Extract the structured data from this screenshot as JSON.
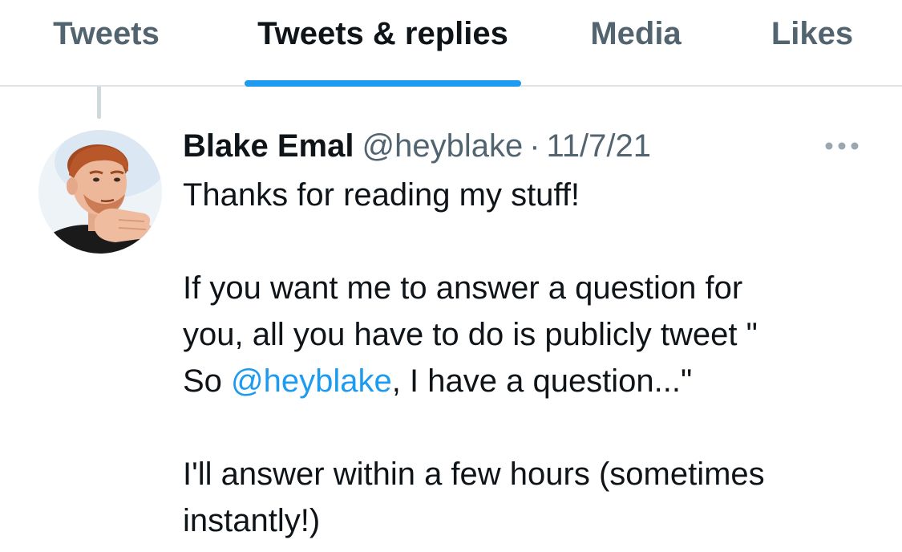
{
  "tabs": [
    {
      "label": "Tweets",
      "active": false
    },
    {
      "label": "Tweets & replies",
      "active": true
    },
    {
      "label": "Media",
      "active": false
    },
    {
      "label": "Likes",
      "active": false
    }
  ],
  "colors": {
    "accent": "#1d9bf0",
    "primary_text": "#0f1419",
    "secondary_text": "#536471",
    "divider": "#dfe4e8"
  },
  "tweet": {
    "author": {
      "name": "Blake Emal",
      "handle": "@heyblake",
      "avatar_icon": "avatar-photo"
    },
    "separator": "·",
    "date": "11/7/21",
    "more_icon": "more-dots-icon",
    "body": {
      "line1": "Thanks for reading my stuff!",
      "line2": "If you want me to answer a question for",
      "line3": "you, all you have to do is publicly tweet \"",
      "line4_prefix": "So ",
      "line4_mention": "@heyblake",
      "line4_suffix": ", I have a question...\"",
      "line5": "I'll answer within a few hours (sometimes",
      "line6": "instantly!)"
    }
  }
}
